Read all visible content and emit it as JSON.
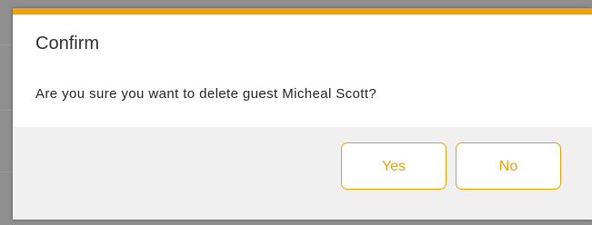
{
  "dialog": {
    "title": "Confirm",
    "message": "Are you sure you want to delete guest Micheal Scott?",
    "yes_label": "Yes",
    "no_label": "No"
  },
  "colors": {
    "accent": "#f2a200",
    "backdrop": "#8f8f8f",
    "footer": "#f0f0f0",
    "surface": "#ffffff"
  }
}
